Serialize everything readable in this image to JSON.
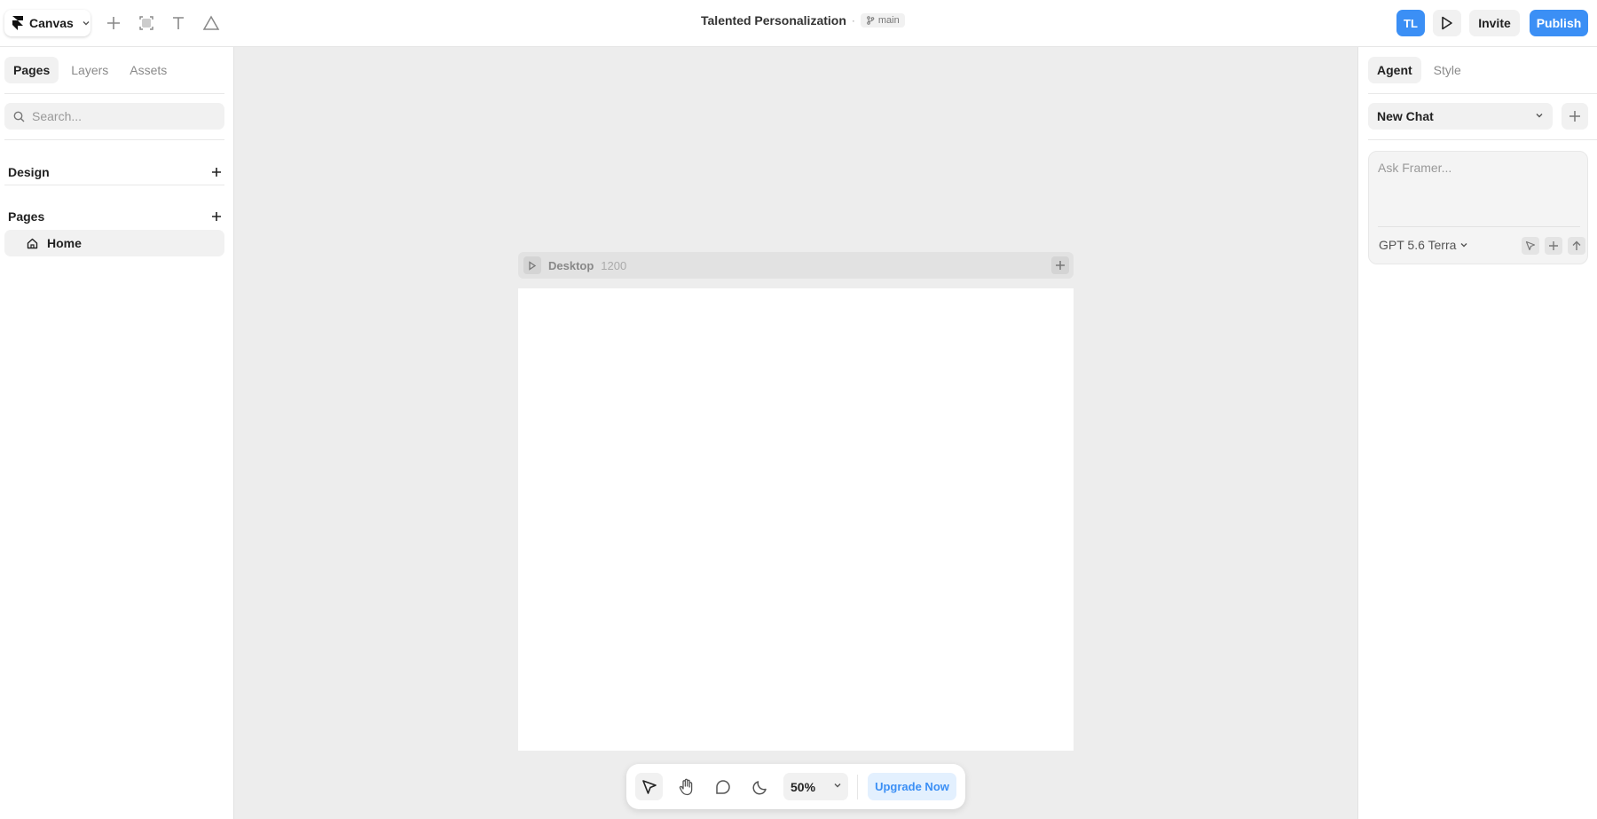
{
  "topbar": {
    "app_menu_label": "Canvas",
    "project_title": "Talented Personalization",
    "separator": "·",
    "branch_name": "main",
    "avatar_initials": "TL",
    "invite_label": "Invite",
    "publish_label": "Publish"
  },
  "left_panel": {
    "tabs": [
      "Pages",
      "Layers",
      "Assets"
    ],
    "active_tab": "Pages",
    "search_placeholder": "Search...",
    "design_section": "Design",
    "pages_section": "Pages",
    "pages": [
      "Home"
    ]
  },
  "canvas": {
    "frame_name": "Desktop",
    "frame_width": "1200"
  },
  "bottom_toolbar": {
    "zoom": "50%",
    "upgrade_label": "Upgrade Now"
  },
  "right_panel": {
    "tabs": [
      "Agent",
      "Style"
    ],
    "active_tab": "Agent",
    "chat_select": "New Chat",
    "ask_placeholder": "Ask Framer...",
    "model": "GPT 5.6 Terra"
  },
  "colors": {
    "accent": "#3b8ff5",
    "canvas_bg": "#ededed"
  }
}
